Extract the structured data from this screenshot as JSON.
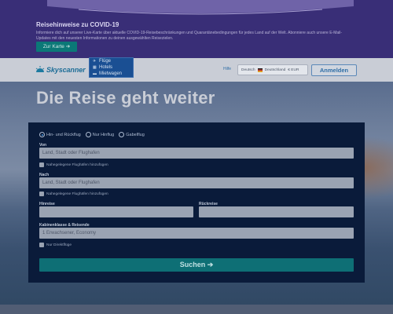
{
  "covid": {
    "title": "Reisehinweise zu COVID-19",
    "text": "Informiere dich auf unserer Live-Karte über aktuelle COVID-19-Reisebeschränkungen und Quarantänebedingungen für jedes Land auf der Welt. Abonniere auch unsere E-Mail-Updates mit den neuesten Informationen zu deinen ausgewählten Reisezielen.",
    "button": "Zur Karte ➔"
  },
  "header": {
    "logo": "Skyscanner",
    "nav": [
      {
        "icon": "plane-icon",
        "glyph": "✈",
        "label": "Flüge"
      },
      {
        "icon": "hotel-icon",
        "glyph": "▦",
        "label": "Hotels"
      },
      {
        "icon": "car-icon",
        "glyph": "▬",
        "label": "Mietwagen"
      }
    ],
    "help": "Hilfe",
    "locale_language": "Deutsch",
    "locale_country": "Deutschland",
    "locale_currency": "€ EUR",
    "login": "Anmelden"
  },
  "hero": {
    "title": "Die Reise geht weiter"
  },
  "form": {
    "trip_types": [
      "Hin- und Rückflug",
      "Nur Hinflug",
      "Gabelflug"
    ],
    "selected_trip": "Hin- und Rückflug",
    "from_label": "Von",
    "from_placeholder": "Land, Stadt oder Flughafen",
    "nearby_from": "Nahegelegene Flughäfen hinzufügen",
    "to_label": "Nach",
    "to_placeholder": "Land, Stadt oder Flughafen",
    "nearby_to": "Nahegelegene Flughäfen hinzufügen",
    "depart_label": "Hinreise",
    "depart_value": "",
    "return_label": "Rückreise",
    "return_value": "",
    "cabin_label": "Kabinenklasse & Reisende",
    "cabin_value": "1 Erwachsener, Economy",
    "direct_only": "Nur Direktflüge",
    "search_button": "Suchen ➔"
  },
  "colors": {
    "brand": "#1d6d97",
    "cta": "#0e6f75",
    "form_bg": "#0a1b3a",
    "covid_bg": "#392e77"
  }
}
